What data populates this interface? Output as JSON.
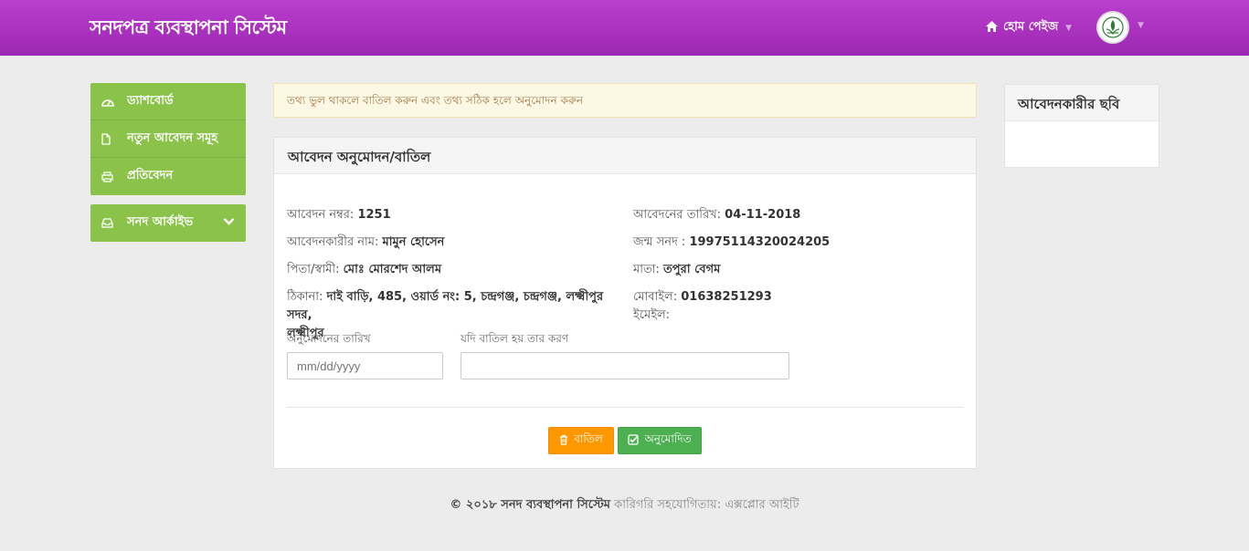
{
  "header": {
    "brand": "সনদপত্র ব্যবস্থাপনা সিস্টেম",
    "home_label": "হোম পেইজ",
    "home_icon": "home-icon",
    "avatar_icon": "emblem-logo"
  },
  "sidebar": {
    "items": [
      {
        "label": "ড্যাশবোর্ড",
        "icon": "dashboard-icon"
      },
      {
        "label": "নতুন আবেদন সমূহ",
        "icon": "file-icon"
      },
      {
        "label": "প্রতিবেদন",
        "icon": "print-icon"
      }
    ],
    "archive": {
      "label": "সনদ আর্কাইভ",
      "icon": "inbox-icon"
    }
  },
  "alert": {
    "text": "তথ্য ভুল থাকলে বাতিল করুন এবং তথ্য সঠিক হলে অনুমোদন করুন"
  },
  "panel": {
    "title": "আবেদন অনুমোদন/বাতিল",
    "application_no_label": "আবেদন নম্বর:",
    "application_no": "1251",
    "application_date_label": "আবেদনের তারিখ:",
    "application_date": "04-11-2018",
    "applicant_name_label": "আবেদনকারীর নাম:",
    "applicant_name": "মামুন হোসেন",
    "birth_cert_label": "জন্ম সনদ :",
    "birth_cert": "19975114320024205",
    "father_label": "পিতা/স্বামী:",
    "father": "মোঃ মোরশেদ আলম",
    "mother_label": "মাতা:",
    "mother": "তপুরা বেগম",
    "address_label": "ঠিকানা:",
    "address_line1": "দাই বাড়ি, 485, ওয়ার্ড নং: 5, চন্দ্রগঞ্জ, চন্দ্রগঞ্জ, লক্ষ্মীপুর সদর,",
    "address_line2": "লক্ষ্মীপুর",
    "mobile_label": "মোবাইল:",
    "mobile": "01638251293",
    "email_label": "ইমেইল:",
    "approve_date_label": "অনুমোদনের তারিখ",
    "approve_date_placeholder": "mm/dd/yyyy",
    "reason_label": "যদি বাতিল হয় তার করণ",
    "reason_value": "",
    "cancel_button": "বাতিল",
    "approve_button": "অনুমোদিত"
  },
  "photo_panel": {
    "title": "আবেদনকারীর ছবি"
  },
  "footer": {
    "copyright": "© ২০১৮ সনদ ব্যবস্থাপনা সিস্টেম",
    "credit": "কারিগরি সহযোগিতায়: এক্সপ্লোর আইটি"
  }
}
